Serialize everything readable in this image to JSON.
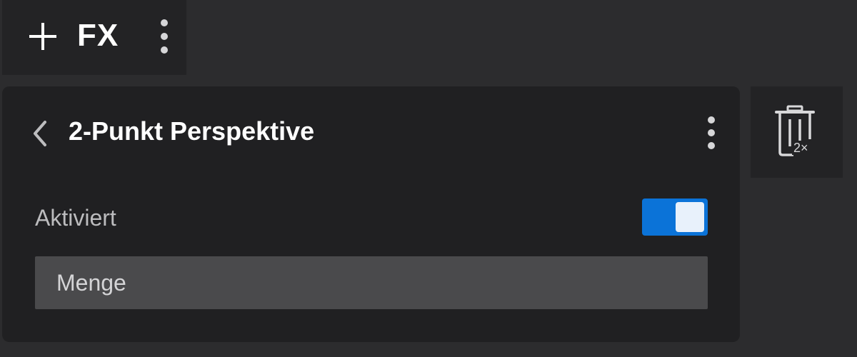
{
  "fx_bar": {
    "add_icon": "plus-icon",
    "label": "FX",
    "more_icon": "vertical-ellipsis-icon"
  },
  "effect_panel": {
    "back_icon": "chevron-left-icon",
    "title": "2-Punkt Perspektive",
    "more_icon": "vertical-ellipsis-icon",
    "enabled_label": "Aktiviert",
    "enabled": true,
    "amount_label": "Menge"
  },
  "trash": {
    "icon": "trash-icon",
    "badge": "2×"
  },
  "colors": {
    "background": "#2c2c2e",
    "panel": "#202022",
    "accent": "#0b73d8",
    "field": "#4a4a4c"
  }
}
